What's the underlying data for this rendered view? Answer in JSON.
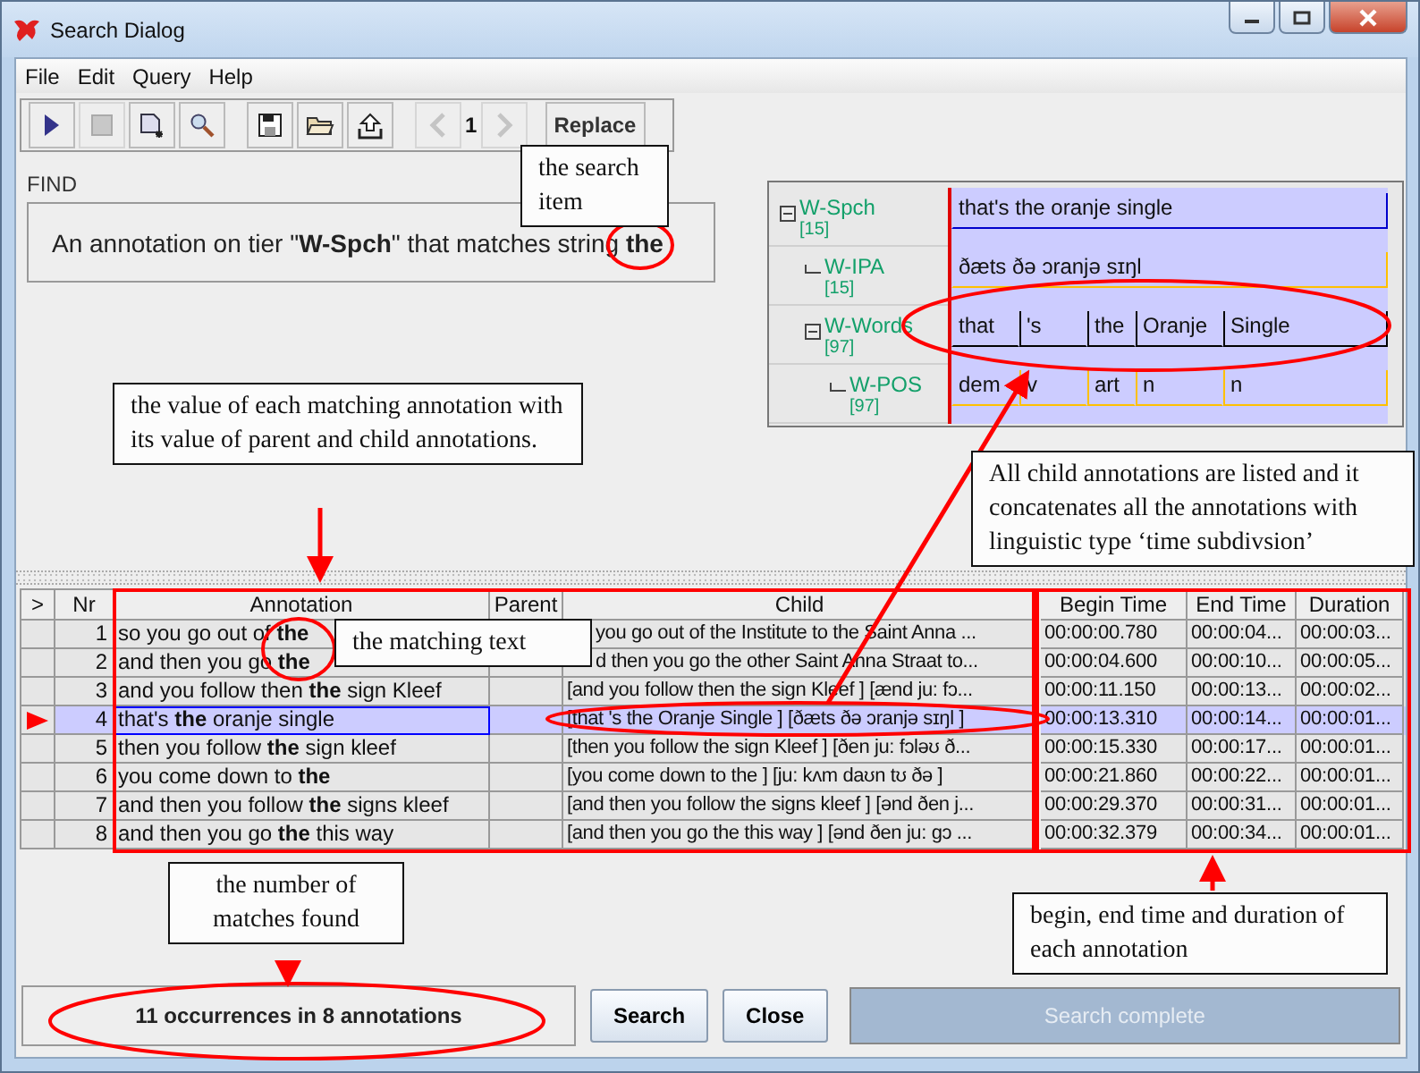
{
  "window": {
    "title": "Search Dialog"
  },
  "menu": [
    "File",
    "Edit",
    "Query",
    "Help"
  ],
  "toolbar": {
    "buttons": [
      {
        "kind": "play",
        "disabled": false
      },
      {
        "kind": "stop",
        "disabled": true
      },
      {
        "kind": "new",
        "disabled": false
      },
      {
        "kind": "find",
        "disabled": false
      },
      {
        "kind": "save",
        "disabled": false
      },
      {
        "kind": "open",
        "disabled": false
      },
      {
        "kind": "export",
        "disabled": false
      }
    ],
    "previous_disabled": true,
    "page": "1",
    "next_disabled": true,
    "replace": "Replace"
  },
  "find": {
    "label": "FIND",
    "query": "An annotation on tier \"**W-Spch**\" that matches string **the**"
  },
  "tier_viewer": {
    "tiers": [
      {
        "name": "W-Spch",
        "count": "[15]",
        "color": "#0000cc",
        "annotations": [
          "that's the oranje single"
        ],
        "children": [
          {
            "name": "W-IPA",
            "count": "[15]",
            "color": "#ffc000",
            "annotations": [
              "ðæts ðə ɔranjə sɪŋl"
            ]
          },
          {
            "name": "W-Words",
            "count": "[97]",
            "color": "#000000",
            "annotations": [
              "that",
              "'s",
              "the",
              "Oranje",
              "Single"
            ],
            "children": [
              {
                "name": "W-POS",
                "count": "[97]",
                "color": "#ffc000",
                "annotations": [
                  "dem",
                  "v",
                  "art",
                  "n",
                  "n"
                ]
              }
            ]
          }
        ]
      }
    ]
  },
  "table": {
    "columns": [
      ">",
      "Nr",
      "Annotation",
      "Parent",
      "Child",
      "Begin Time",
      "End Time",
      "Duration"
    ],
    "rows": [
      {
        "nr": "1",
        "annotation": "so you go out of **the**",
        "child": "you go out of the Institute to the Saint Anna ...",
        "begin": "00:00:00.780",
        "end": "00:00:04...",
        "duration": "00:00:03...",
        "selected": false
      },
      {
        "nr": "2",
        "annotation": "and then you go **the**",
        "child": "d then you go the other Saint Anna Straat to...",
        "begin": "00:00:04.600",
        "end": "00:00:10...",
        "duration": "00:00:05...",
        "selected": false
      },
      {
        "nr": "3",
        "annotation": "and you follow then **the** sign Kleef",
        "child": "[and you follow then the sign Kleef ] [ænd ju: fɔ...",
        "begin": "00:00:11.150",
        "end": "00:00:13...",
        "duration": "00:00:02...",
        "selected": false
      },
      {
        "nr": "4",
        "annotation": "that's **the** oranje single",
        "child": "[that 's the Oranje Single ] [ðæts ðə ɔranjə sɪŋl ]",
        "begin": "00:00:13.310",
        "end": "00:00:14...",
        "duration": "00:00:01...",
        "selected": true
      },
      {
        "nr": "5",
        "annotation": "then you follow **the** sign kleef",
        "child": "[then you follow the sign Kleef ] [ðen ju: fɔləʊ ð...",
        "begin": "00:00:15.330",
        "end": "00:00:17...",
        "duration": "00:00:01...",
        "selected": false
      },
      {
        "nr": "6",
        "annotation": "you come down to **the**",
        "child": "[you come down to the ] [ju: kʌm daʊn tʊ ðə ]",
        "begin": "00:00:21.860",
        "end": "00:00:22...",
        "duration": "00:00:01...",
        "selected": false
      },
      {
        "nr": "7",
        "annotation": "and then you follow **the** signs kleef",
        "child": "[and then you follow the signs kleef ] [ənd ðen j...",
        "begin": "00:00:29.370",
        "end": "00:00:31...",
        "duration": "00:00:01...",
        "selected": false
      },
      {
        "nr": "8",
        "annotation": "and then you go **the** this way",
        "child": "[and then you go the this way ] [ənd ðen ju: gɔ ...",
        "begin": "00:00:32.379",
        "end": "00:00:34...",
        "duration": "00:00:01...",
        "selected": false
      }
    ]
  },
  "bottom": {
    "status": "11 occurrences in 8 annotations",
    "buttons": [
      "Search",
      "Close"
    ],
    "progress": {
      "label": "Search complete",
      "level": 1
    }
  },
  "callouts": [
    "the search item",
    "the value of each matching annotation with its value of parent and child annotations.",
    "All child annotations are listed and it concatenates all the annotations with linguistic type ‘time subdivsion’",
    "the matching text",
    "the number of matches found",
    "begin, end time and duration of each annotation"
  ]
}
